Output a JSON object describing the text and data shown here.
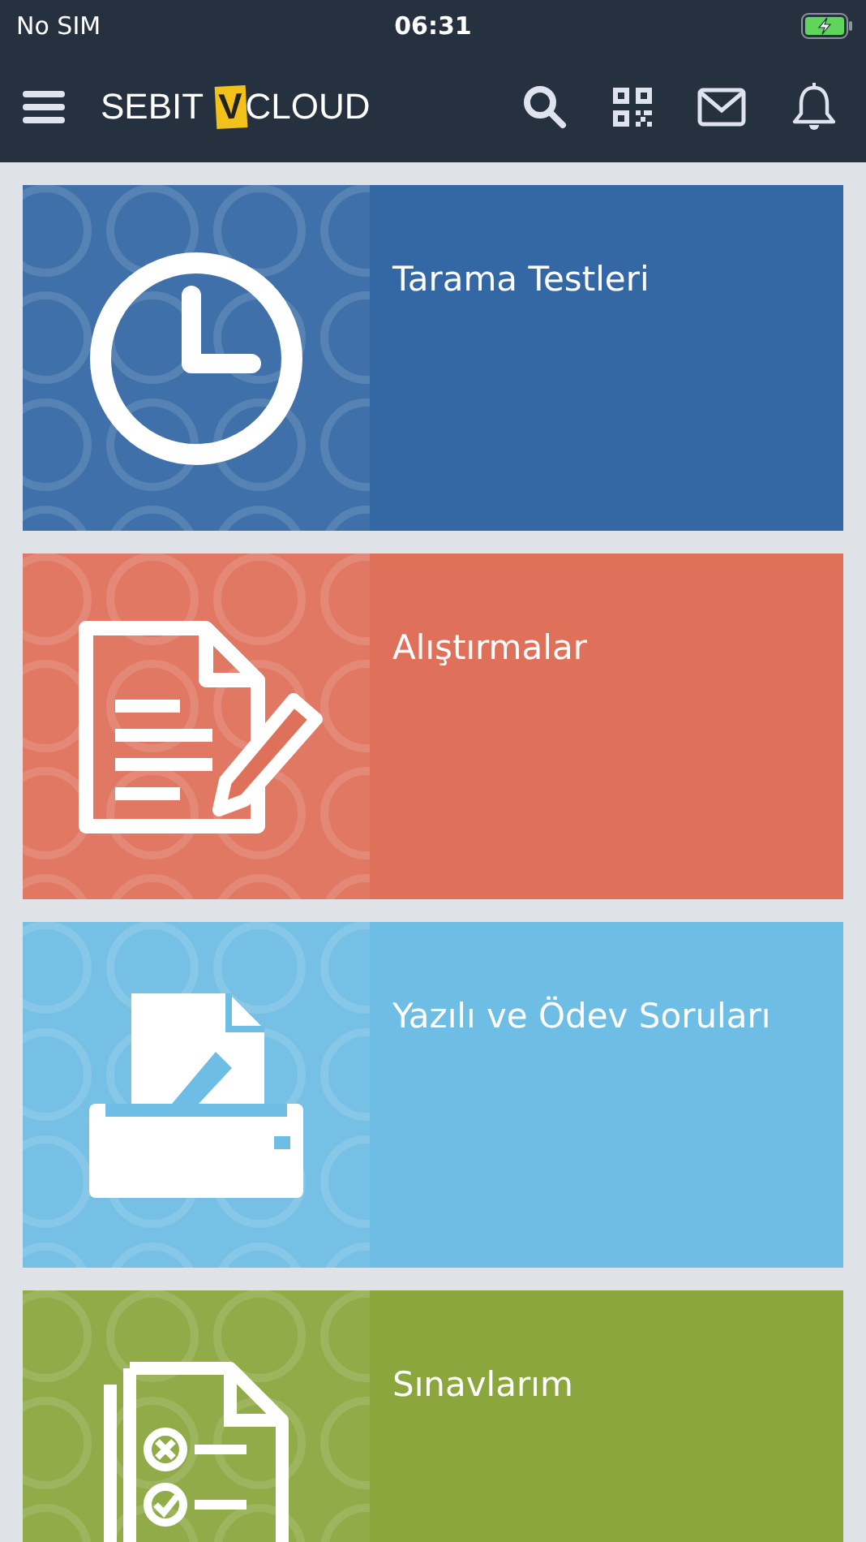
{
  "status_bar": {
    "carrier": "No SIM",
    "time": "06:31"
  },
  "nav_bar": {
    "logo": {
      "before": "SEBIT",
      "mark": "V",
      "after": "CLOUD"
    }
  },
  "tiles": [
    {
      "kind": "clock",
      "title": "Tarama Testleri",
      "color": "#3468a4"
    },
    {
      "kind": "worksheet",
      "title": "Alıştırmalar",
      "color": "#df705a"
    },
    {
      "kind": "printer",
      "title": "Yazılı ve Ödev Soruları",
      "color": "#6ebde5"
    },
    {
      "kind": "checklist",
      "title": "Sınavlarım",
      "color": "#8aa63d"
    }
  ]
}
